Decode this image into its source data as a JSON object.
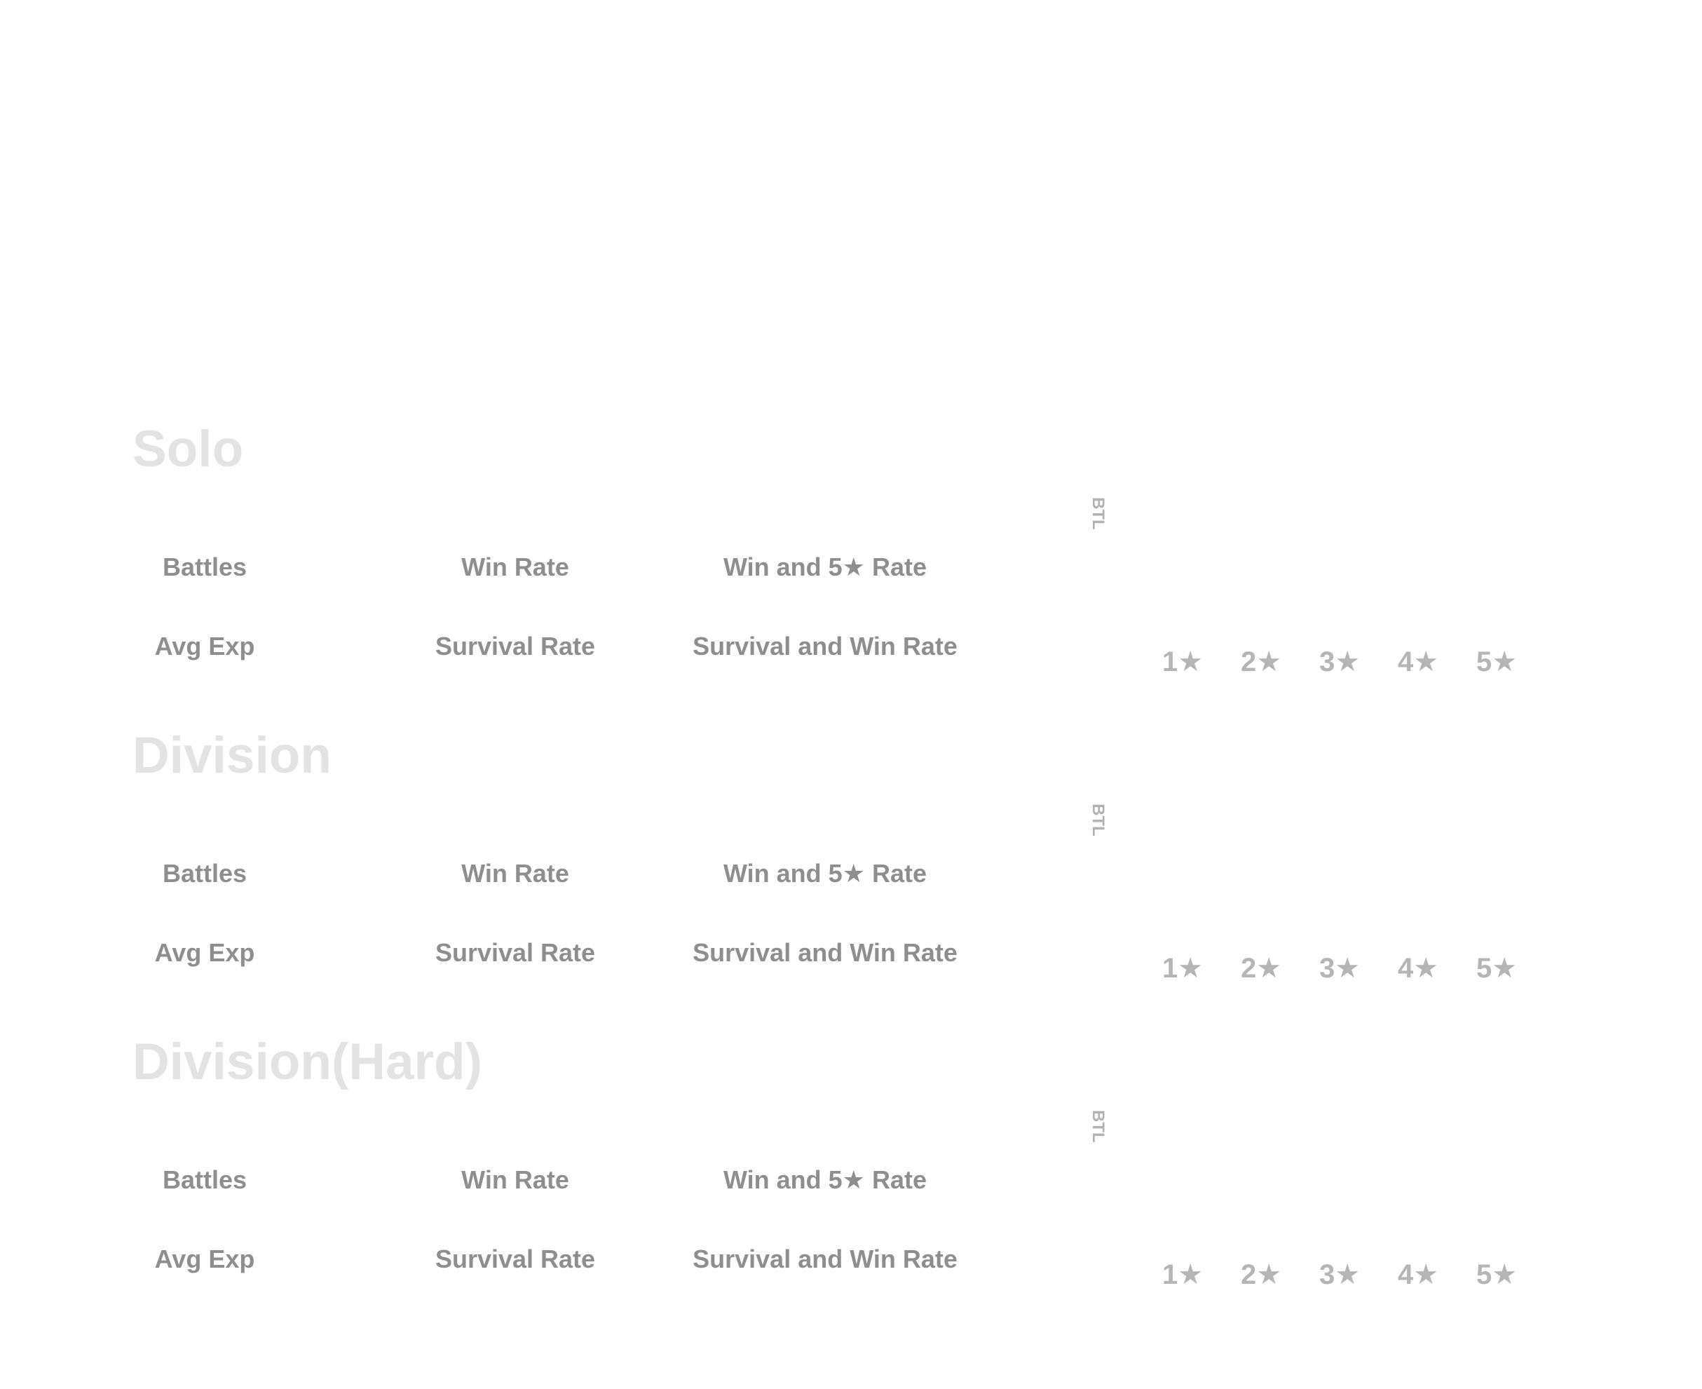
{
  "sections": [
    {
      "title": "Solo",
      "battles_label": "Battles",
      "win_rate_label": "Win Rate",
      "win_5star_rate_label": "Win and 5★ Rate",
      "avg_exp_label": "Avg Exp",
      "survival_rate_label": "Survival Rate",
      "survival_win_rate_label": "Survival and Win Rate",
      "btl_label": "BTL",
      "star_labels": [
        "1★",
        "2★",
        "3★",
        "4★",
        "5★"
      ]
    },
    {
      "title": "Division",
      "battles_label": "Battles",
      "win_rate_label": "Win Rate",
      "win_5star_rate_label": "Win and 5★ Rate",
      "avg_exp_label": "Avg Exp",
      "survival_rate_label": "Survival Rate",
      "survival_win_rate_label": "Survival and Win Rate",
      "btl_label": "BTL",
      "star_labels": [
        "1★",
        "2★",
        "3★",
        "4★",
        "5★"
      ]
    },
    {
      "title": "Division(Hard)",
      "battles_label": "Battles",
      "win_rate_label": "Win Rate",
      "win_5star_rate_label": "Win and 5★ Rate",
      "avg_exp_label": "Avg Exp",
      "survival_rate_label": "Survival Rate",
      "survival_win_rate_label": "Survival and Win Rate",
      "btl_label": "BTL",
      "star_labels": [
        "1★",
        "2★",
        "3★",
        "4★",
        "5★"
      ]
    }
  ]
}
